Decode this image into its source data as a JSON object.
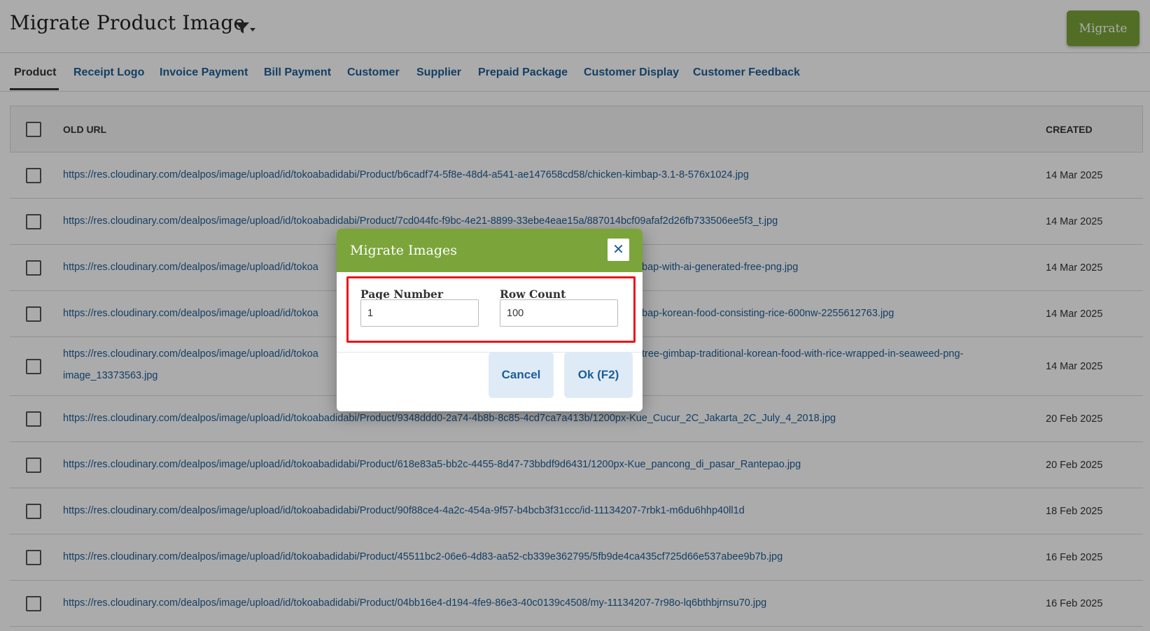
{
  "header": {
    "title": "Migrate Product Image",
    "filter_icon": "filter-dropdown-icon",
    "migrate_label": "Migrate",
    "accent_color": "#7ba53a"
  },
  "tabs": [
    {
      "label": "Product",
      "active": true
    },
    {
      "label": "Receipt Logo",
      "active": false
    },
    {
      "label": "Invoice Payment",
      "active": false
    },
    {
      "label": "Bill Payment",
      "active": false
    },
    {
      "label": "Customer",
      "active": false
    },
    {
      "label": "Supplier",
      "active": false
    },
    {
      "label": "Prepaid Package",
      "active": false
    },
    {
      "label": "Customer Display",
      "active": false
    },
    {
      "label": "Customer Feedback",
      "active": false
    }
  ],
  "table": {
    "columns": {
      "old_url": "OLD URL",
      "created": "CREATED"
    },
    "rows": [
      {
        "url": "https://res.cloudinary.com/dealpos/image/upload/id/tokoabadidabi/Product/b6cadf74-5f8e-48d4-a541-ae147658cd58/chicken-kimbap-3.1-8-576x1024.jpg",
        "created": "14 Mar 2025"
      },
      {
        "url": "https://res.cloudinary.com/dealpos/image/upload/id/tokoabadidabi/Product/7cd044fc-f9bc-4e21-8899-33ebe4eae15a/887014bcf09afaf2d26fb733506ee5f3_t.jpg",
        "created": "14 Mar 2025"
      },
      {
        "url": "https://res.cloudinary.com/dealpos/image/upload/id/tokoa",
        "url_tail": "bap-with-ai-generated-free-png.jpg",
        "created": "14 Mar 2025"
      },
      {
        "url": "https://res.cloudinary.com/dealpos/image/upload/id/tokoa",
        "url_tail": "bap-korean-food-consisting-rice-600nw-2255612763.jpg",
        "created": "14 Mar 2025"
      },
      {
        "url": "https://res.cloudinary.com/dealpos/image/upload/id/tokoa",
        "url_tail": "tree-gimbap-traditional-korean-food-with-rice-wrapped-in-seaweed-png-",
        "url_line2": "image_13373563.jpg",
        "created": "14 Mar 2025"
      },
      {
        "url": "https://res.cloudinary.com/dealpos/image/upload/id/tokoabadidabi/Product/9348ddd0-2a74-4b8b-8c85-4cd7ca7a413b/1200px-Kue_Cucur_2C_Jakarta_2C_July_4_2018.jpg",
        "created": "20 Feb 2025"
      },
      {
        "url": "https://res.cloudinary.com/dealpos/image/upload/id/tokoabadidabi/Product/618e83a5-bb2c-4455-8d47-73bbdf9d6431/1200px-Kue_pancong_di_pasar_Rantepao.jpg",
        "created": "20 Feb 2025"
      },
      {
        "url": "https://res.cloudinary.com/dealpos/image/upload/id/tokoabadidabi/Product/90f88ce4-4a2c-454a-9f57-b4bcb3f31ccc/id-11134207-7rbk1-m6du6hhp40ll1d",
        "created": "18 Feb 2025"
      },
      {
        "url": "https://res.cloudinary.com/dealpos/image/upload/id/tokoabadidabi/Product/45511bc2-06e6-4d83-aa52-cb339e362795/5fb9de4ca435cf725d66e537abee9b7b.jpg",
        "created": "16 Feb 2025"
      },
      {
        "url": "https://res.cloudinary.com/dealpos/image/upload/id/tokoabadidabi/Product/04bb16e4-d194-4fe9-86e3-40c0139c4508/my-11134207-7r98o-lq6bthbjrnsu70.jpg",
        "created": "16 Feb 2025"
      }
    ]
  },
  "modal": {
    "title": "Migrate Images",
    "close_icon": "close-icon",
    "page_number_label": "Page Number",
    "page_number_value": "1",
    "row_count_label": "Row Count",
    "row_count_value": "100",
    "cancel_label": "Cancel",
    "ok_label": "Ok (F2)",
    "highlight_color": "#e8161c"
  }
}
